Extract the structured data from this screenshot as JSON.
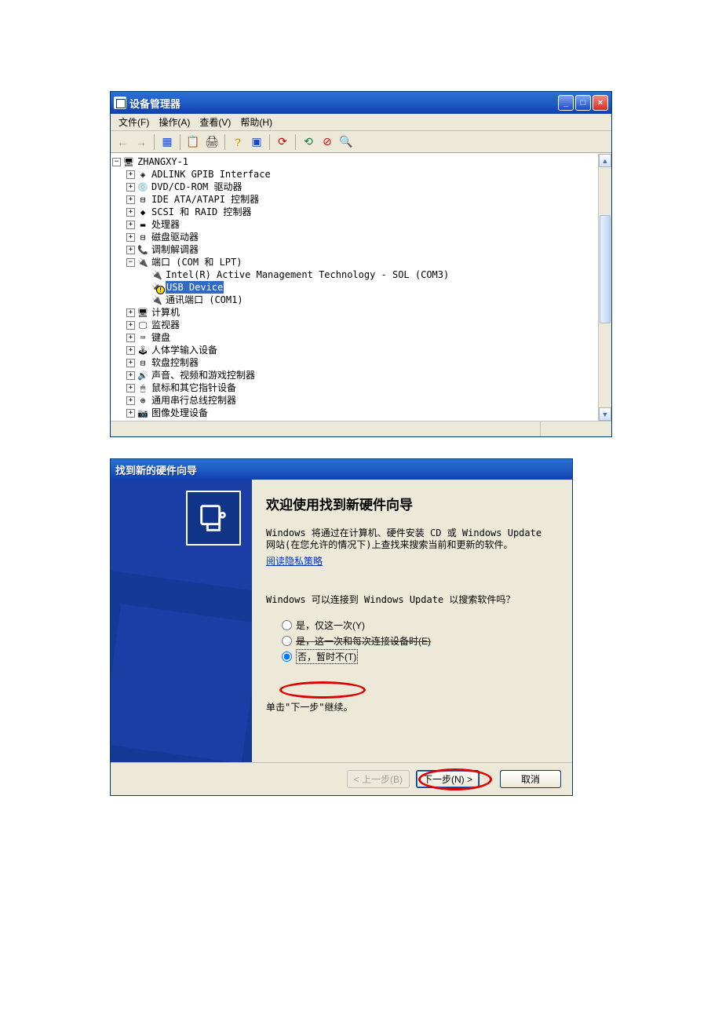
{
  "device_manager": {
    "title": "设备管理器",
    "menus": {
      "file": "文件(F)",
      "action": "操作(A)",
      "view": "查看(V)",
      "help": "帮助(H)"
    },
    "root_node": "ZHANGXY-1",
    "nodes": {
      "adlink": "ADLINK GPIB Interface",
      "dvd": "DVD/CD-ROM 驱动器",
      "ide": "IDE ATA/ATAPI 控制器",
      "scsi": "SCSI 和 RAID 控制器",
      "cpu": "处理器",
      "disk": "磁盘驱动器",
      "modem": "调制解调器",
      "ports": "端口 (COM 和 LPT)",
      "port_sol": "Intel(R) Active Management Technology - SOL (COM3)",
      "port_usb": "USB Device",
      "port_com1": "通讯端口 (COM1)",
      "computer": "计算机",
      "monitor": "监视器",
      "keyboard": "键盘",
      "hid": "人体学输入设备",
      "floppy": "软盘控制器",
      "sound": "声音、视频和游戏控制器",
      "mouse": "鼠标和其它指针设备",
      "usb_ctrl": "通用串行总线控制器",
      "imaging": "图像处理设备"
    }
  },
  "wizard": {
    "title": "找到新的硬件向导",
    "heading": "欢迎使用找到新硬件向导",
    "para1": "Windows 将通过在计算机、硬件安装 CD 或 Windows Update 网站(在您允许的情况下)上查找来搜索当前和更新的软件。",
    "link": "阅读隐私策略",
    "question": "Windows 可以连接到 Windows Update 以搜索软件吗？",
    "radio1": "是，仅这一次(Y)",
    "radio2": "是，这一次和每次连接设备时(E)",
    "radio3": "否，暂时不(T)",
    "continue": "单击\"下一步\"继续。",
    "buttons": {
      "back": "< 上一步(B)",
      "next": "下一步(N) >",
      "cancel": "取消"
    }
  }
}
